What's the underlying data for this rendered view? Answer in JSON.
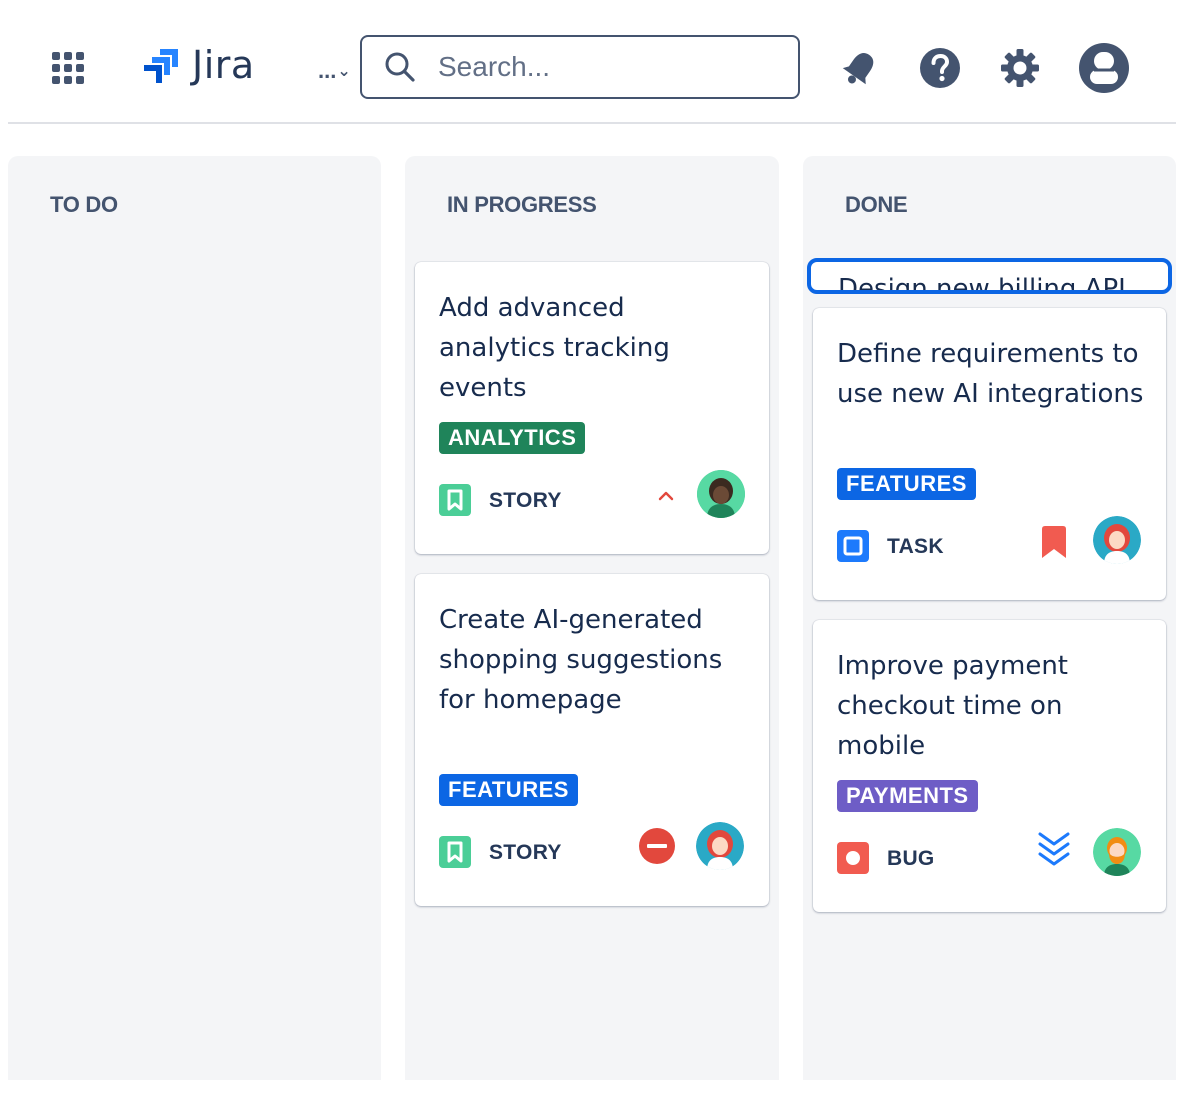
{
  "app": {
    "name": "Jira"
  },
  "header": {
    "more_label": "...",
    "search_placeholder": "Search...",
    "icons": [
      "app-switcher-icon",
      "jira-logo-icon",
      "search-icon",
      "notification-bell-icon",
      "help-icon",
      "settings-gear-icon",
      "profile-avatar-icon"
    ]
  },
  "board": {
    "columns": [
      {
        "title": "TO DO",
        "cards": []
      },
      {
        "title": "IN PROGRESS",
        "cards": [
          {
            "title": "Add advanced analytics tracking events",
            "label": "ANALYTICS",
            "label_color": "#1f845a",
            "type": "STORY",
            "type_color": "#4bce97",
            "priority": "medium-chevron-up",
            "priority_color": "#e2483d",
            "assignee_avatar": "avatar-dark-hair"
          },
          {
            "title": "Create AI-generated shopping suggestions for homepage",
            "label": "FEATURES",
            "label_color": "#0c66e4",
            "type": "STORY",
            "type_color": "#4bce97",
            "priority": "blocker",
            "priority_color": "#e2483d",
            "assignee_avatar": "avatar-red-hair"
          }
        ]
      },
      {
        "title": "DONE",
        "dragging_card": {
          "title": "Design new billing API"
        },
        "cards": [
          {
            "title": "Define requirements to use new AI integrations",
            "label": "FEATURES",
            "label_color": "#0c66e4",
            "type": "TASK",
            "type_color": "#1d7afc",
            "priority": "highest-flag",
            "priority_color": "#f15b50",
            "assignee_avatar": "avatar-red-hair"
          },
          {
            "title": "Improve payment checkout time on mobile",
            "label": "PAYMENTS",
            "label_color": "#6e5dc6",
            "type": "BUG",
            "type_color": "#f15b50",
            "priority": "lowest-double-chevron-down",
            "priority_color": "#1d7afc",
            "assignee_avatar": "avatar-bearded"
          }
        ]
      }
    ]
  }
}
